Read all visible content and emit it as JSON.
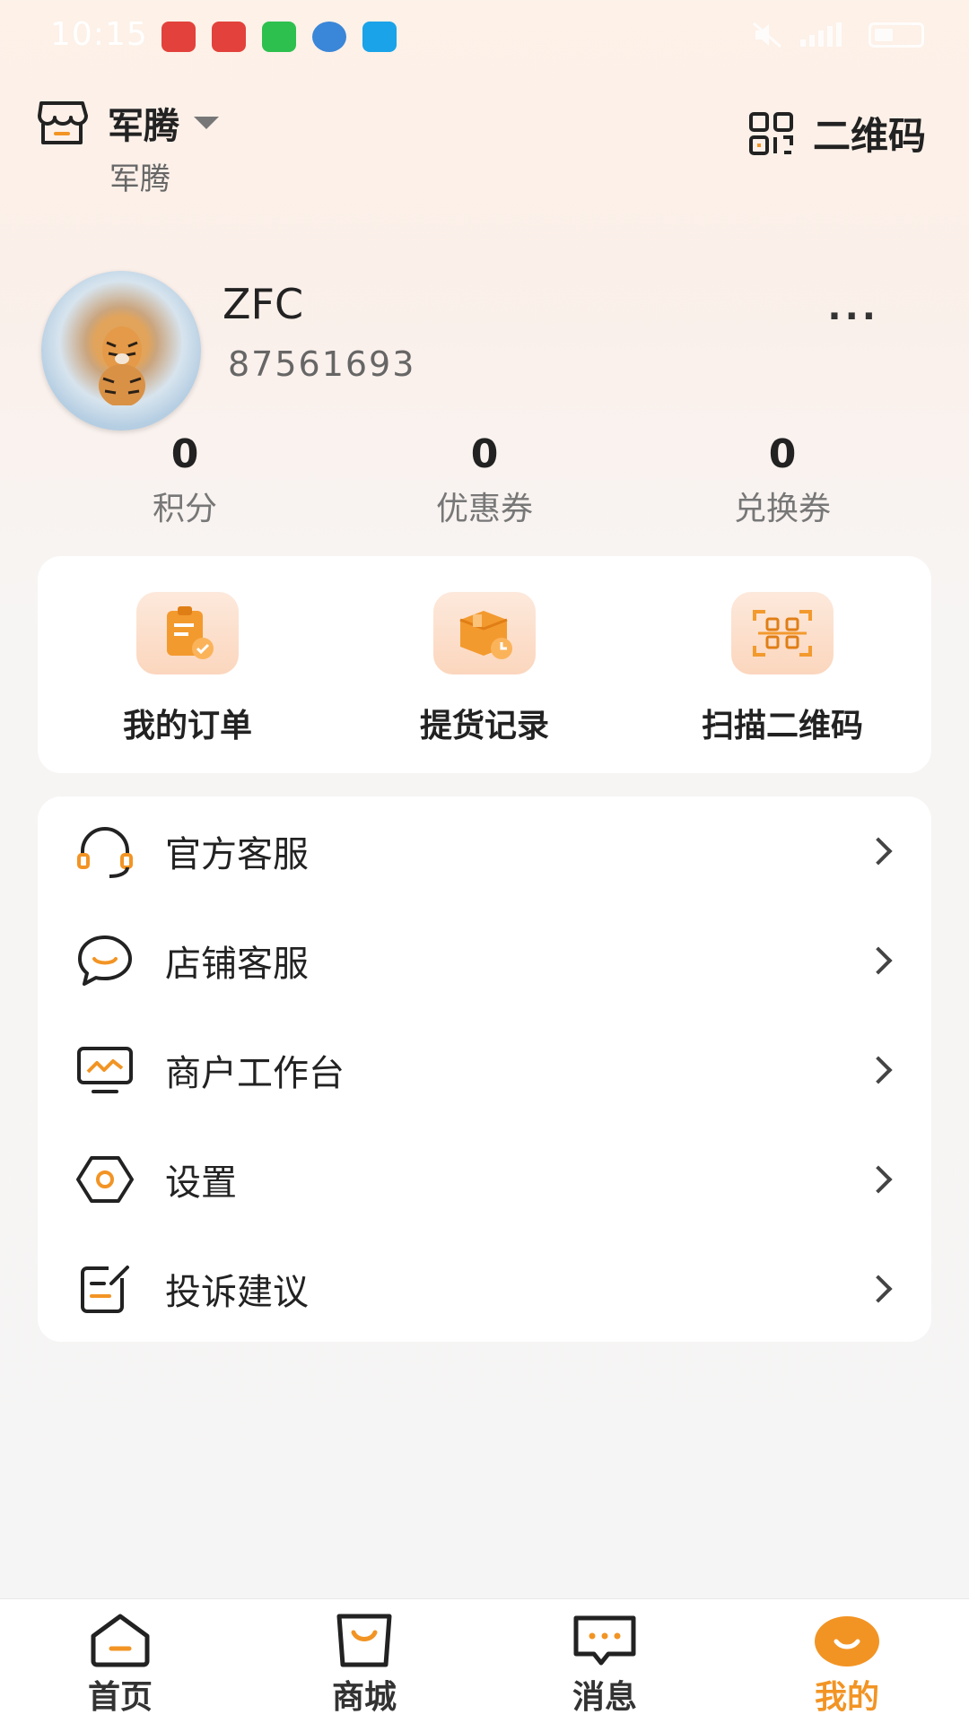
{
  "status_bar": {
    "time": "10:15"
  },
  "header": {
    "store_name": "军腾",
    "store_subtitle": "军腾",
    "qr_label": "二维码"
  },
  "profile": {
    "name": "ZFC",
    "id": "87561693",
    "more_label": "···"
  },
  "stats": [
    {
      "value": "0",
      "label": "积分"
    },
    {
      "value": "0",
      "label": "优惠券"
    },
    {
      "value": "0",
      "label": "兑换券"
    }
  ],
  "quick_actions": [
    {
      "label": "我的订单",
      "icon": "order-clipboard-icon"
    },
    {
      "label": "提货记录",
      "icon": "package-clock-icon"
    },
    {
      "label": "扫描二维码",
      "icon": "scan-qr-icon"
    }
  ],
  "menu": [
    {
      "label": "官方客服",
      "icon": "headset-icon"
    },
    {
      "label": "店铺客服",
      "icon": "chat-bubble-icon"
    },
    {
      "label": "商户工作台",
      "icon": "monitor-chart-icon"
    },
    {
      "label": "设置",
      "icon": "settings-hexagon-icon"
    },
    {
      "label": "投诉建议",
      "icon": "edit-note-icon"
    }
  ],
  "tabbar": [
    {
      "label": "首页",
      "icon": "home-icon",
      "active": false
    },
    {
      "label": "商城",
      "icon": "shopping-bag-icon",
      "active": false
    },
    {
      "label": "消息",
      "icon": "message-icon",
      "active": false
    },
    {
      "label": "我的",
      "icon": "profile-smile-icon",
      "active": true
    }
  ],
  "colors": {
    "accent": "#f29424",
    "text": "#222222",
    "muted": "#777777"
  }
}
